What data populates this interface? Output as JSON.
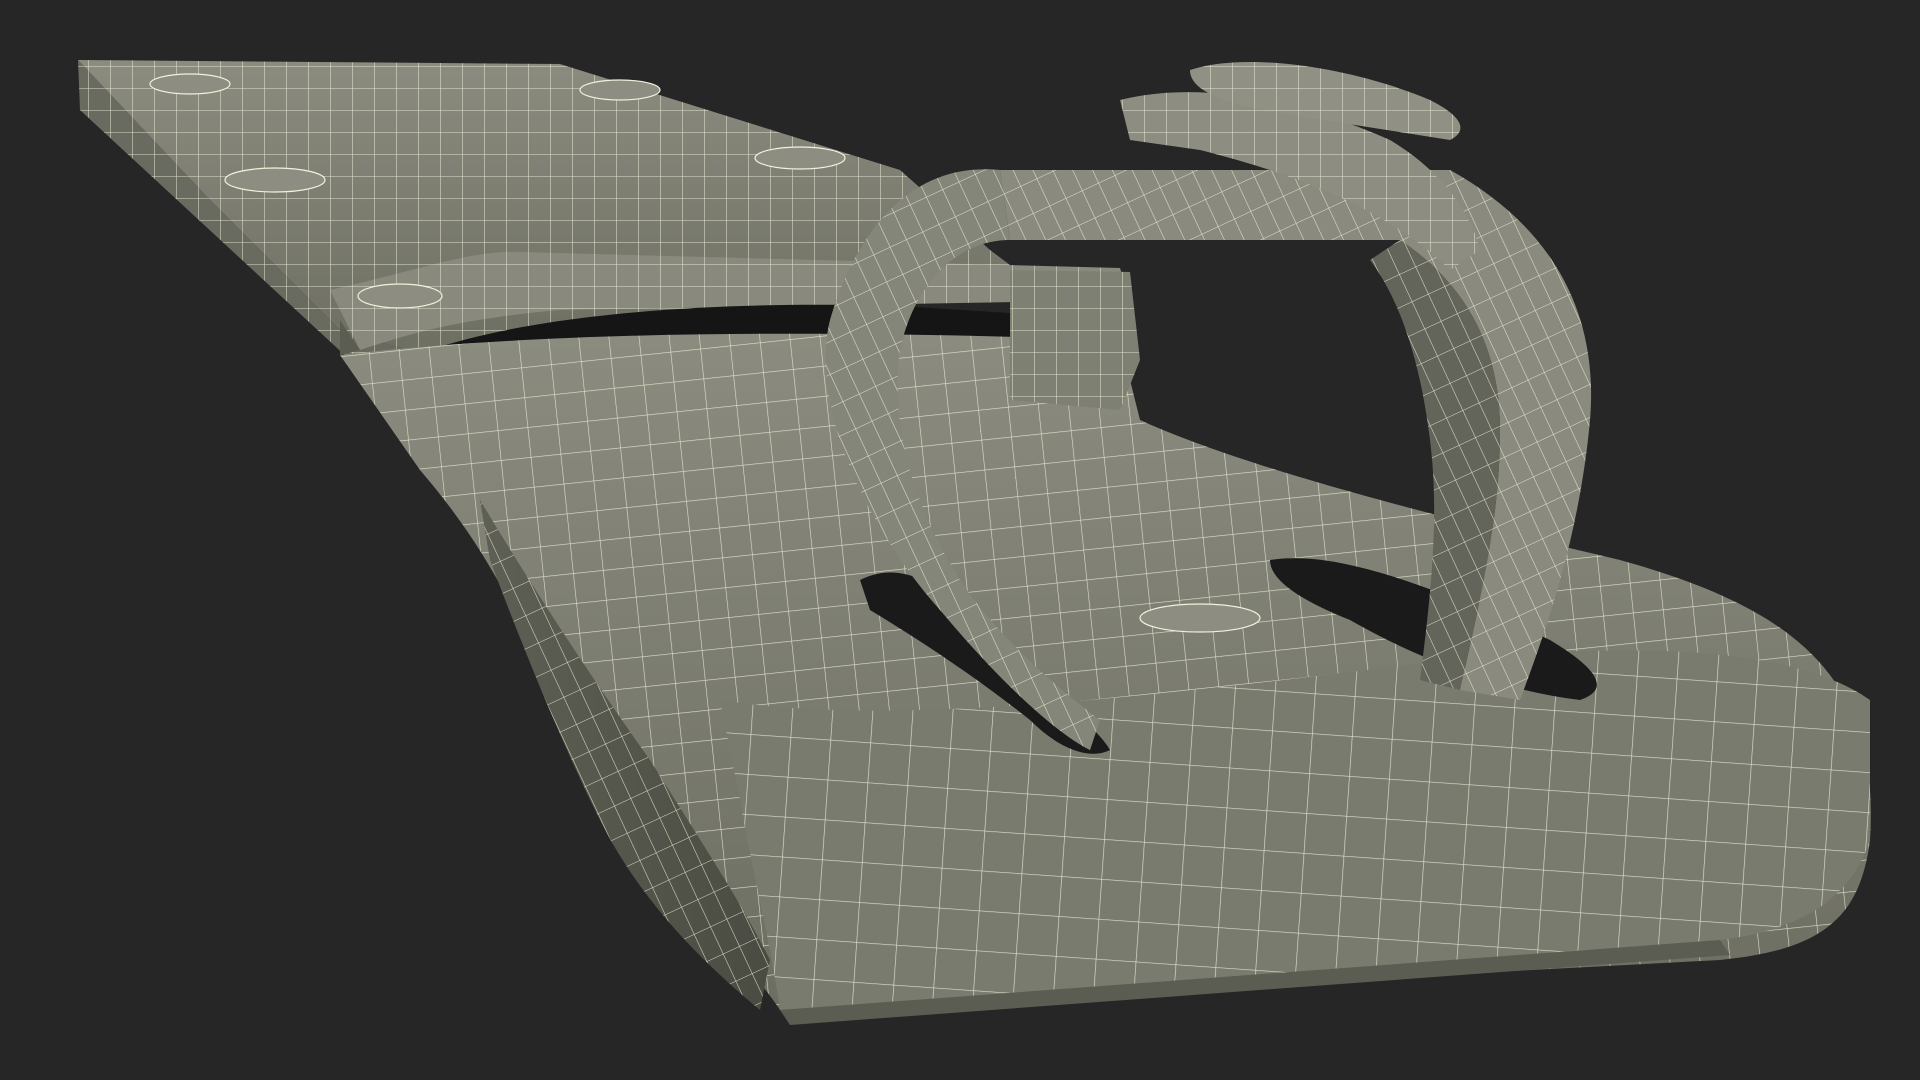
{
  "scene": {
    "subject": "wireframe-3d-render",
    "colors": {
      "background": "#262626",
      "surface": "#7e7f72",
      "surface_light": "#9a9b8e",
      "surface_dark": "#5c5d52",
      "shadow": "#151515",
      "wire": "#f3f1dc"
    }
  }
}
